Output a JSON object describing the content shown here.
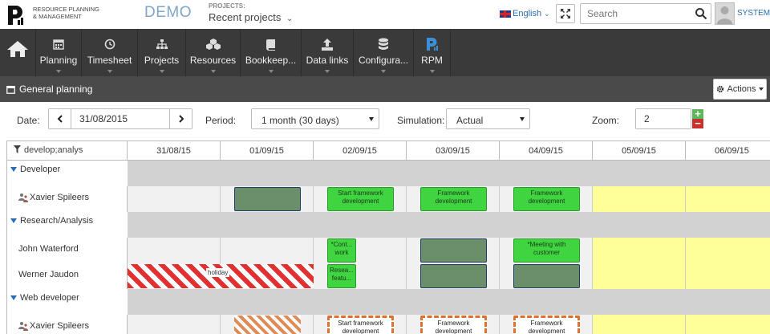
{
  "brand": {
    "logo_line1": "RESOURCE PLANNING",
    "logo_line2": "& MANAGEMENT",
    "env": "DEMO"
  },
  "topbar": {
    "projects_label": "PROJECTS:",
    "projects_value": "Recent projects",
    "language": "English",
    "search_placeholder": "Search",
    "user": "SYSTEM"
  },
  "nav": {
    "items": [
      {
        "label": "Planning",
        "icon": "calendar-icon"
      },
      {
        "label": "Timesheet",
        "icon": "clock-icon"
      },
      {
        "label": "Projects",
        "icon": "sitemap-icon"
      },
      {
        "label": "Resources",
        "icon": "cubes-icon"
      },
      {
        "label": "Bookkeep...",
        "icon": "book-icon"
      },
      {
        "label": "Data links",
        "icon": "upload-icon"
      },
      {
        "label": "Configura...",
        "icon": "database-icon"
      },
      {
        "label": "RPM",
        "icon": "rpm-logo-icon"
      }
    ]
  },
  "subheader": {
    "title": "General planning",
    "actions": "Actions"
  },
  "filters": {
    "date_label": "Date:",
    "date_value": "31/08/2015",
    "period_label": "Period:",
    "period_value": "1 month (30 days)",
    "simulation_label": "Simulation:",
    "simulation_value": "Actual",
    "zoom_label": "Zoom:",
    "zoom_value": "2",
    "zoom_plus": "+",
    "zoom_minus": "−"
  },
  "grid": {
    "filter_text": "develop;analys",
    "days": [
      "31/08/15",
      "01/09/15",
      "02/09/15",
      "03/09/15",
      "04/09/15",
      "05/09/15",
      "06/09/15"
    ],
    "groups": {
      "developer": "Developer",
      "research": "Research/Analysis",
      "web": "Web developer"
    },
    "people": {
      "xavier": "Xavier Spileers",
      "john": "John Waterford",
      "werner": "Werner Jaudon",
      "xavier2": "Xavier Spileers"
    },
    "tasks": {
      "start_framework": "Start framework development",
      "framework_dev": "Framework development",
      "cont_work": "*Cont... work",
      "meeting": "*Meeting with customer",
      "resea": "Resea... featu...",
      "holiday": "holiday"
    }
  },
  "colors": {
    "nav_bg": "#3a3a3a",
    "booked": "#6b8f6b",
    "green_task": "#40d440",
    "weekend": "#ffff99",
    "holiday_stripe": "#e03030",
    "planned_dash": "#e07030"
  }
}
